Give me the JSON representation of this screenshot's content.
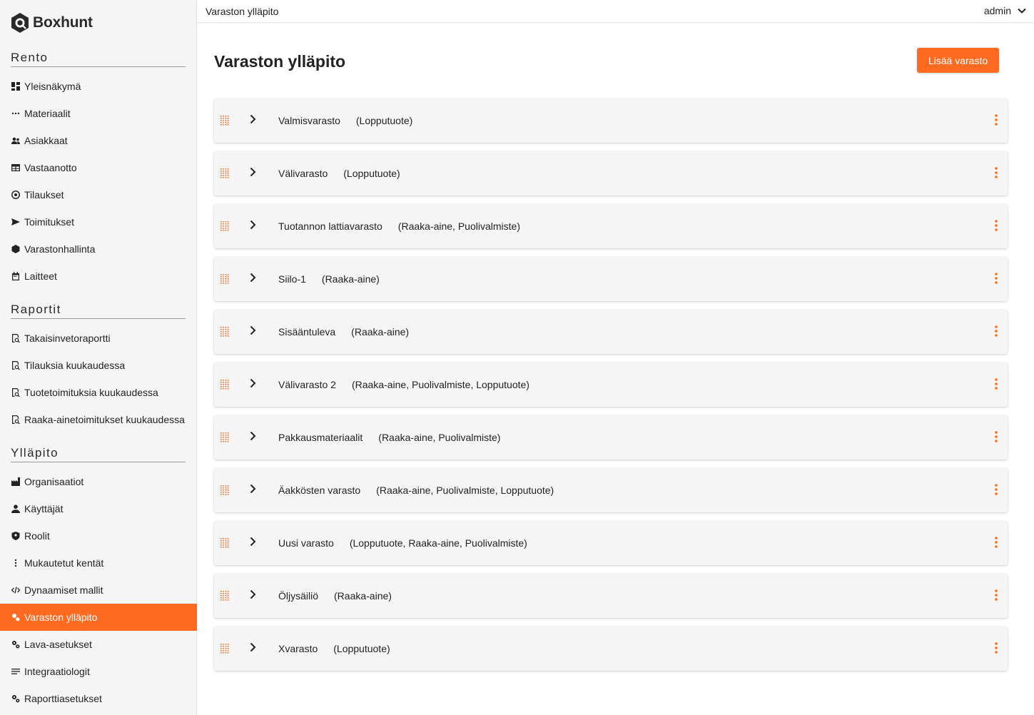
{
  "app": {
    "name": "Boxhunt"
  },
  "topbar": {
    "title": "Varaston ylläpito",
    "user": "admin"
  },
  "sidebar": {
    "sections": [
      {
        "title": "Rento",
        "items": [
          {
            "label": "Yleisnäkymä",
            "icon": "dashboard-icon"
          },
          {
            "label": "Materiaalit",
            "icon": "more-horiz-icon"
          },
          {
            "label": "Asiakkaat",
            "icon": "people-icon"
          },
          {
            "label": "Vastaanotto",
            "icon": "table-icon"
          },
          {
            "label": "Tilaukset",
            "icon": "support-icon"
          },
          {
            "label": "Toimitukset",
            "icon": "send-icon"
          },
          {
            "label": "Varastonhallinta",
            "icon": "cube-icon"
          },
          {
            "label": "Laitteet",
            "icon": "calendar-icon"
          }
        ]
      },
      {
        "title": "Raportit",
        "items": [
          {
            "label": "Takaisinvetoraportti",
            "icon": "report-search-icon"
          },
          {
            "label": "Tilauksia kuukaudessa",
            "icon": "report-search-icon"
          },
          {
            "label": "Tuotetoimituksia kuukaudessa",
            "icon": "report-search-icon"
          },
          {
            "label": "Raaka-ainetoimitukset kuukaudessa",
            "icon": "report-search-icon"
          }
        ]
      },
      {
        "title": "Ylläpito",
        "items": [
          {
            "label": "Organisaatiot",
            "icon": "factory-icon"
          },
          {
            "label": "Käyttäjät",
            "icon": "person-icon"
          },
          {
            "label": "Roolit",
            "icon": "shield-icon"
          },
          {
            "label": "Mukautetut kentät",
            "icon": "more-vert-icon"
          },
          {
            "label": "Dynaamiset mallit",
            "icon": "code-icon"
          },
          {
            "label": "Varaston ylläpito",
            "icon": "gears-icon",
            "active": true
          },
          {
            "label": "Lava-asetukset",
            "icon": "gears-icon"
          },
          {
            "label": "Integraatiologit",
            "icon": "lines-icon"
          },
          {
            "label": "Raporttiasetukset",
            "icon": "gears-icon"
          }
        ]
      }
    ]
  },
  "main": {
    "title": "Varaston ylläpito",
    "add_button": "Lisää varasto",
    "warehouses": [
      {
        "name": "Valmisvarasto",
        "types": "(Lopputuote)"
      },
      {
        "name": "Välivarasto",
        "types": "(Lopputuote)"
      },
      {
        "name": "Tuotannon lattiavarasto",
        "types": "(Raaka-aine, Puolivalmiste)"
      },
      {
        "name": "Siilo-1",
        "types": "(Raaka-aine)"
      },
      {
        "name": "Sisääntuleva",
        "types": "(Raaka-aine)"
      },
      {
        "name": "Välivarasto 2",
        "types": "(Raaka-aine, Puolivalmiste, Lopputuote)"
      },
      {
        "name": "Pakkausmateriaalit",
        "types": "(Raaka-aine, Puolivalmiste)"
      },
      {
        "name": "Äakkösten varasto",
        "types": "(Raaka-aine, Puolivalmiste, Lopputuote)"
      },
      {
        "name": "Uusi varasto",
        "types": "(Lopputuote, Raaka-aine, Puolivalmiste)"
      },
      {
        "name": "Öljysäiliö",
        "types": "(Raaka-aine)"
      },
      {
        "name": "Xvarasto",
        "types": "(Lopputuote)"
      }
    ]
  },
  "colors": {
    "accent": "#ff6a21",
    "sidebar_bg": "#f5f5f5",
    "row_bg": "#f5f5f5"
  }
}
